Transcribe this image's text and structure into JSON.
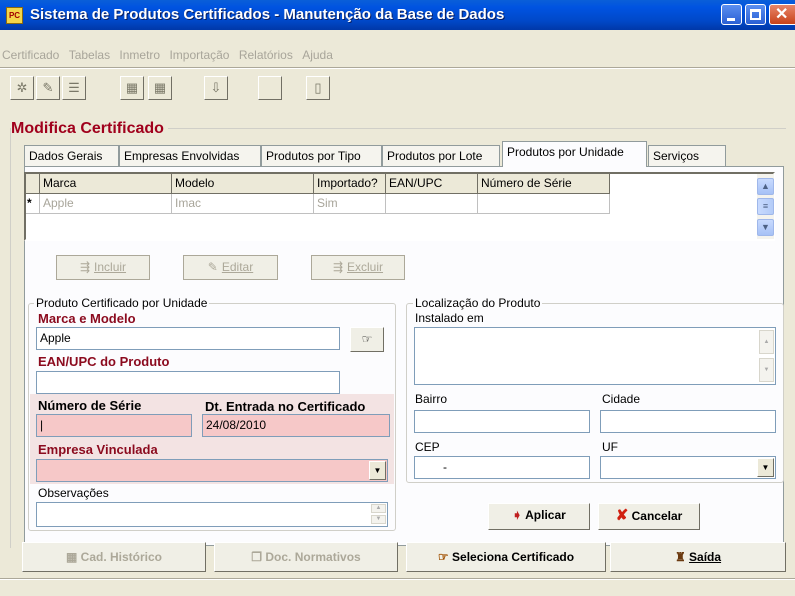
{
  "window": {
    "title": "Sistema de Produtos Certificados - Manutenção da Base de Dados",
    "icon": "app-certificate-icon"
  },
  "menu": [
    "Certificado",
    "Tabelas",
    "Inmetro",
    "Importação",
    "Relatórios",
    "Ajuda"
  ],
  "form": {
    "heading": "Modifica Certificado"
  },
  "tabs": [
    {
      "label": "Dados Gerais",
      "active": false
    },
    {
      "label": "Empresas Envolvidas",
      "active": false
    },
    {
      "label": "Produtos por Tipo",
      "active": false
    },
    {
      "label": "Produtos por Lote",
      "active": false
    },
    {
      "label": "Produtos por Unidade",
      "active": true
    },
    {
      "label": "Serviços",
      "active": false
    }
  ],
  "grid": {
    "columns": [
      "Marca",
      "Modelo",
      "Importado?",
      "EAN/UPC",
      "Número de Série"
    ],
    "new_row_marker": "*",
    "rows": [
      [
        "Apple",
        "Imac",
        "Sim",
        "",
        ""
      ]
    ]
  },
  "grid_actions": {
    "include": "Incluir",
    "edit": "Editar",
    "delete": "Excluir"
  },
  "product_unit": {
    "group_title": "Produto Certificado por Unidade",
    "brand_model_label": "Marca e Modelo",
    "brand_model_value": "Apple",
    "ean_label": "EAN/UPC do Produto",
    "ean_value": "",
    "serial_label": "Número de Série",
    "serial_value": "|",
    "entry_date_label": "Dt. Entrada no Certificado",
    "entry_date_value": "24/08/2010",
    "company_label": "Empresa Vinculada",
    "company_value": "",
    "notes_label": "Observações",
    "notes_value": ""
  },
  "location": {
    "group_title": "Localização do Produto",
    "installed_label": "Instalado em",
    "installed_value": "",
    "bairro_label": "Bairro",
    "bairro_value": "",
    "cidade_label": "Cidade",
    "cidade_value": "",
    "cep_label": "CEP",
    "cep_value": "-",
    "uf_label": "UF",
    "uf_value": ""
  },
  "dialog_buttons": {
    "apply": "Aplicar",
    "cancel": "Cancelar"
  },
  "bottom_buttons": {
    "history": "Cad. Histórico",
    "normative_docs": "Doc. Normativos",
    "select_certificate": "Seleciona Certificado",
    "exit": "Saída"
  },
  "colors": {
    "required_label": "#8b0a1e",
    "required_field": "#f6c8c8",
    "titlebar": "#0053e1"
  }
}
